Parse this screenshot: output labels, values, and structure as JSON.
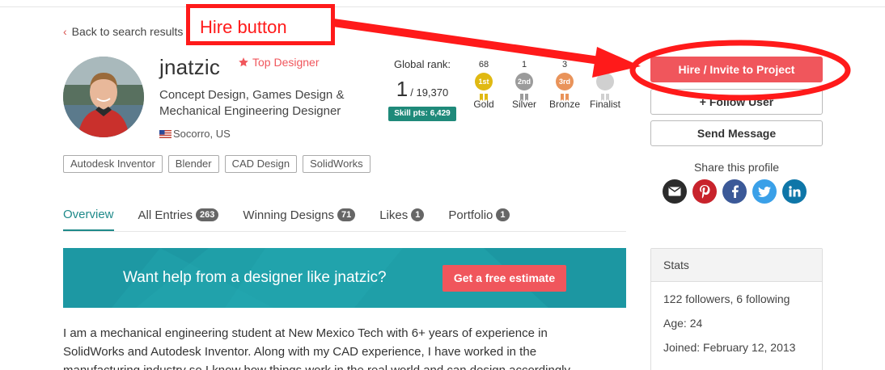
{
  "nav": {
    "back_label": "Back to search results"
  },
  "profile": {
    "username": "jnatzic",
    "top_designer_label": "Top Designer",
    "tagline_line1": "Concept Design, Games Design &",
    "tagline_line2": "Mechanical Engineering Designer",
    "location": "Socorro, US"
  },
  "rank": {
    "label": "Global rank:",
    "position": "1",
    "total": "/ 19,370",
    "skill_points": "Skill pts: 6,429"
  },
  "medals": [
    {
      "count": "68",
      "badge": "1st",
      "name": "Gold",
      "color": "#e0b912"
    },
    {
      "count": "1",
      "badge": "2nd",
      "name": "Silver",
      "color": "#9b9b9b"
    },
    {
      "count": "3",
      "badge": "3rd",
      "name": "Bronze",
      "color": "#e9935a"
    },
    {
      "count": "",
      "badge": "",
      "name": "Finalist",
      "color": "#d0d0d0"
    }
  ],
  "tags": [
    "Autodesk Inventor",
    "Blender",
    "CAD Design",
    "SolidWorks"
  ],
  "actions": {
    "hire_label": "Hire / Invite to Project",
    "follow_label": "Follow User",
    "message_label": "Send Message"
  },
  "share": {
    "title": "Share this profile",
    "icons": [
      "email-icon",
      "pinterest-icon",
      "facebook-icon",
      "twitter-icon",
      "linkedin-icon"
    ]
  },
  "tabs": [
    {
      "label": "Overview",
      "count": ""
    },
    {
      "label": "All Entries",
      "count": "263"
    },
    {
      "label": "Winning Designs",
      "count": "71"
    },
    {
      "label": "Likes",
      "count": "1"
    },
    {
      "label": "Portfolio",
      "count": "1"
    }
  ],
  "banner": {
    "text": "Want help from a designer like jnatzic?",
    "cta_label": "Get a free estimate"
  },
  "bio": {
    "line1": "I am a mechanical engineering student at New Mexico Tech with 6+ years of experience in",
    "line2": "SolidWorks and Autodesk Inventor. Along with my CAD experience, I have worked in the",
    "line3": "manufacturing industry so I know how things work in the real world and can design accordingly."
  },
  "stats": {
    "title": "Stats",
    "followers": "122 followers, 6 following",
    "age": "Age: 24",
    "joined": "Joined: February 12, 2013"
  },
  "annotation": {
    "label": "Hire button"
  },
  "colors": {
    "accent": "#f0565c",
    "teal": "#1f8a8a",
    "banner": "#1f9fa8",
    "annotation": "#ff1a1a"
  }
}
